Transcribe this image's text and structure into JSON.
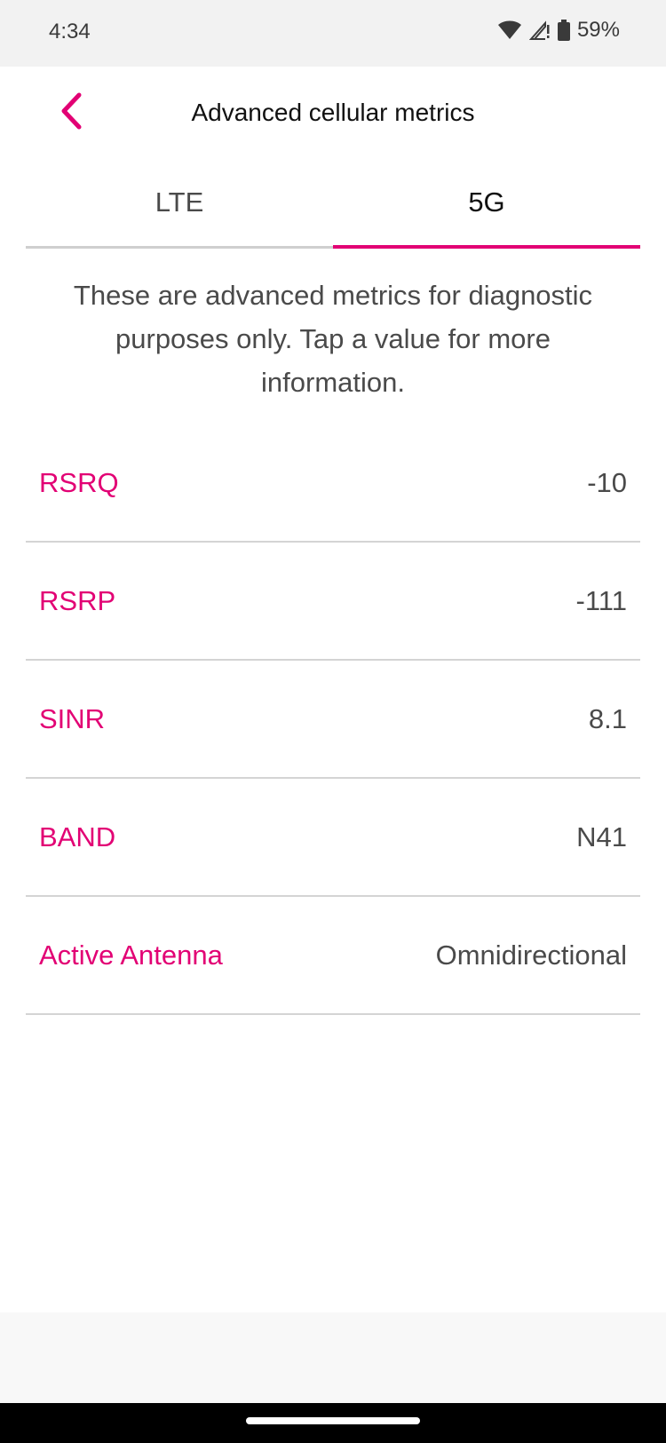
{
  "status_bar": {
    "time": "4:34",
    "battery": "59%",
    "icons": [
      "wifi-icon",
      "cell-signal-icon",
      "battery-icon"
    ]
  },
  "header": {
    "title": "Advanced cellular metrics",
    "back_icon": "chevron-left-icon"
  },
  "tabs": [
    {
      "label": "LTE",
      "active": false
    },
    {
      "label": "5G",
      "active": true
    }
  ],
  "description": "These are advanced metrics for diagnostic purposes only. Tap a value for more information.",
  "metrics": [
    {
      "label": "RSRQ",
      "value": "-10"
    },
    {
      "label": "RSRP",
      "value": "-111"
    },
    {
      "label": "SINR",
      "value": "8.1"
    },
    {
      "label": "BAND",
      "value": "N41"
    },
    {
      "label": "Active Antenna",
      "value": "Omnidirectional"
    }
  ],
  "colors": {
    "accent": "#e20074",
    "text_primary": "#111111",
    "text_secondary": "#4a4a4a",
    "divider": "#d4d4d4"
  }
}
